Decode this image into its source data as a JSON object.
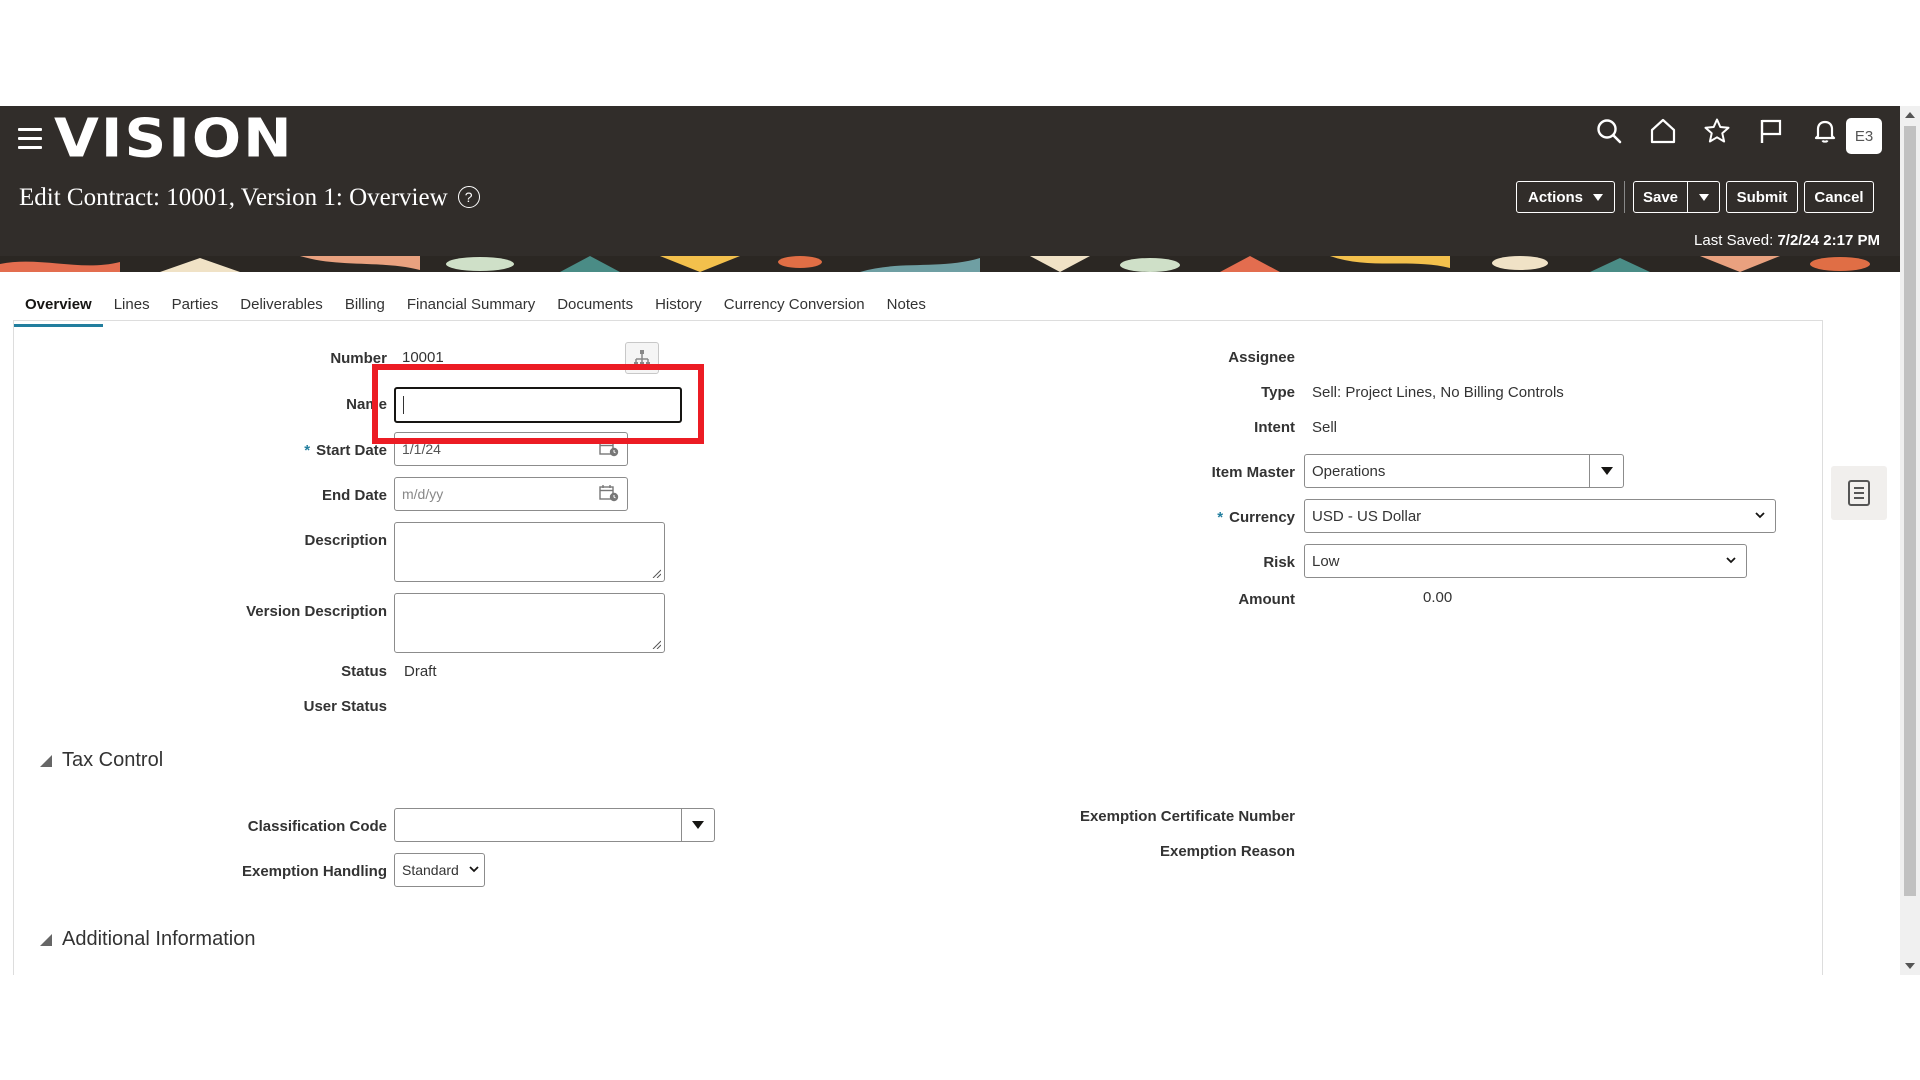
{
  "app": {
    "logo": "VISION",
    "avatar_initials": "E3"
  },
  "header": {
    "page_title": "Edit Contract: 10001, Version 1: Overview",
    "help_glyph": "?",
    "actions_label": "Actions",
    "save_label": "Save",
    "submit_label": "Submit",
    "cancel_label": "Cancel",
    "last_saved_label": "Last Saved:",
    "last_saved_value": "7/2/24 2:17 PM"
  },
  "tabs": [
    {
      "label": "Overview",
      "active": true
    },
    {
      "label": "Lines"
    },
    {
      "label": "Parties"
    },
    {
      "label": "Deliverables"
    },
    {
      "label": "Billing"
    },
    {
      "label": "Financial Summary"
    },
    {
      "label": "Documents"
    },
    {
      "label": "History"
    },
    {
      "label": "Currency Conversion"
    },
    {
      "label": "Notes"
    }
  ],
  "left_form": {
    "number_label": "Number",
    "number_value": "10001",
    "name_label": "Name",
    "name_value": "",
    "start_date_label": "Start Date",
    "start_date_value": "1/1/24",
    "end_date_label": "End Date",
    "end_date_placeholder": "m/d/yy",
    "description_label": "Description",
    "version_description_label": "Version Description",
    "status_label": "Status",
    "status_value": "Draft",
    "user_status_label": "User Status",
    "required_mark": "*"
  },
  "right_form": {
    "assignee_label": "Assignee",
    "type_label": "Type",
    "type_value": "Sell: Project Lines, No Billing Controls",
    "intent_label": "Intent",
    "intent_value": "Sell",
    "item_master_label": "Item Master",
    "item_master_value": "Operations",
    "currency_label": "Currency",
    "currency_value": "USD - US Dollar",
    "risk_label": "Risk",
    "risk_value": "Low",
    "amount_label": "Amount",
    "amount_value": "0.00"
  },
  "tax_control": {
    "title": "Tax Control",
    "classification_code_label": "Classification Code",
    "exemption_handling_label": "Exemption Handling",
    "exemption_handling_value": "Standard",
    "exemption_certificate_label": "Exemption Certificate Number",
    "exemption_reason_label": "Exemption Reason"
  },
  "additional_information": {
    "title": "Additional Information"
  },
  "colors": {
    "header_bg": "#312d2a",
    "highlight": "#ec1c24",
    "tab_accent": "#227e9e"
  },
  "icons": [
    "menu-icon",
    "search-icon",
    "home-icon",
    "star-icon",
    "flag-icon",
    "bell-icon",
    "calendar-icon",
    "hierarchy-icon",
    "document-icon"
  ]
}
